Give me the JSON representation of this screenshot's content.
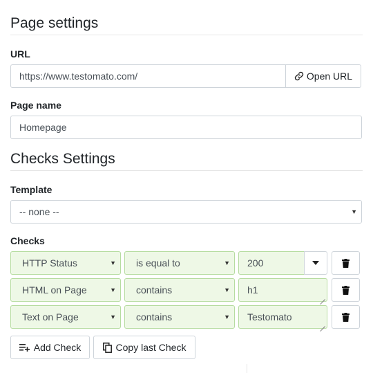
{
  "page_settings": {
    "title": "Page settings",
    "url_label": "URL",
    "url_value": "https://www.testomato.com/",
    "open_url_label": "Open URL",
    "page_name_label": "Page name",
    "page_name_value": "Homepage"
  },
  "checks_settings": {
    "title": "Checks Settings",
    "template_label": "Template",
    "template_value": "-- none --",
    "checks_label": "Checks",
    "checks": [
      {
        "type": "HTTP Status",
        "operator": "is equal to",
        "value": "200"
      },
      {
        "type": "HTML on Page",
        "operator": "contains",
        "value": "h1"
      },
      {
        "type": "Text on Page",
        "operator": "contains",
        "value": "Testomato"
      }
    ],
    "add_check_label": "Add Check",
    "copy_last_check_label": "Copy last Check"
  },
  "colors": {
    "check_field_bg": "#eef8e6",
    "check_field_border": "#b6dca0"
  },
  "icons": {
    "open_url": "link-icon",
    "dropdown": "caret-down-icon",
    "delete": "trash-icon",
    "add": "playlist-add-icon",
    "copy": "copy-icon"
  }
}
